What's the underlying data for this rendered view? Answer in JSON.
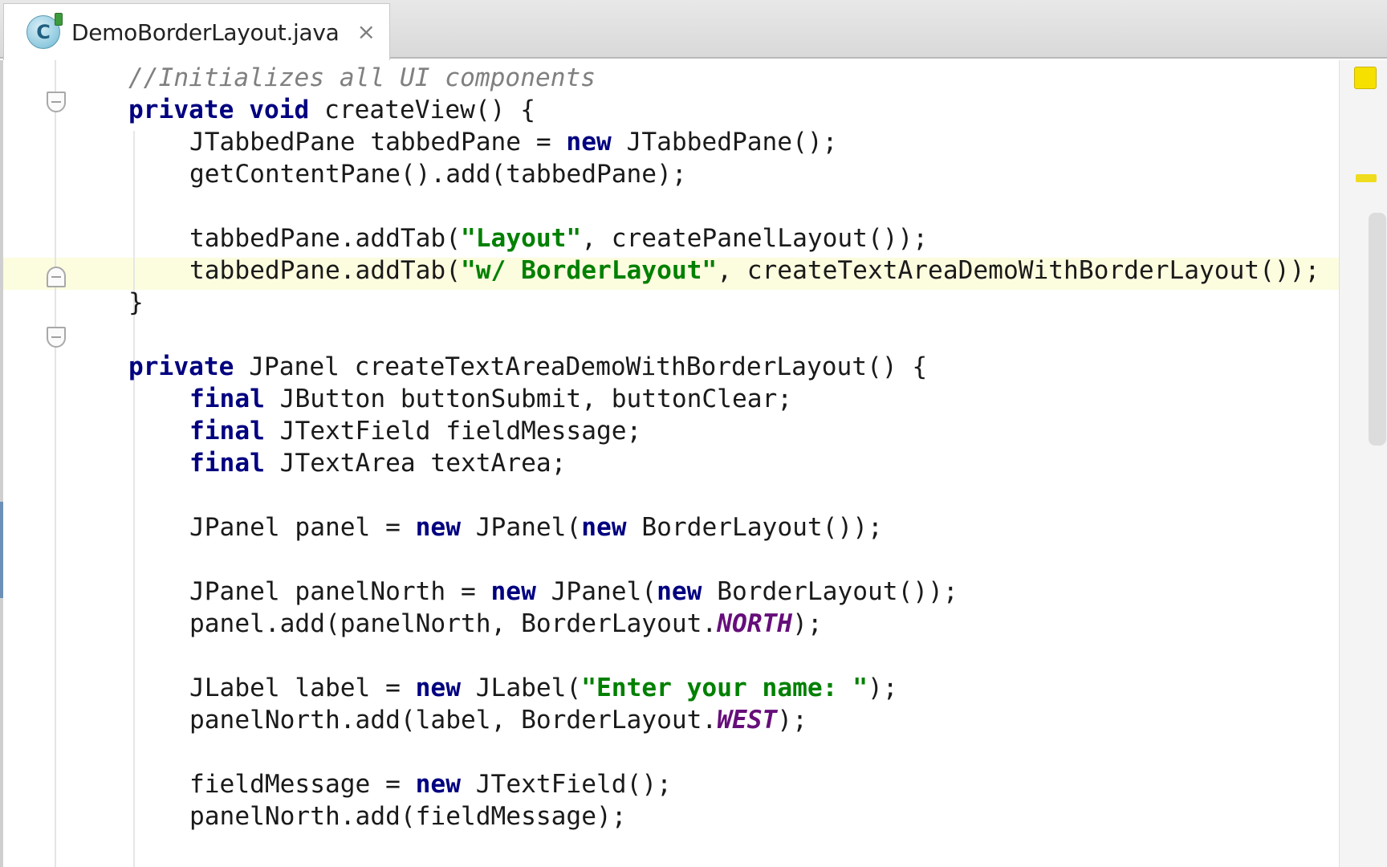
{
  "tab": {
    "title": "DemoBorderLayout.java",
    "close_glyph": "×",
    "icon_letter": "C",
    "icon": "java-class-icon"
  },
  "code": {
    "line1": "//Initializes all UI components",
    "line2": {
      "k1": "private",
      "k2": "void",
      "rest": " createView() {"
    },
    "line3": {
      "a": "JTabbedPane tabbedPane = ",
      "k": "new",
      "b": " JTabbedPane();"
    },
    "line4": "getContentPane().add(tabbedPane);",
    "line6": {
      "a": "tabbedPane.addTab(",
      "s": "\"Layout\"",
      "b": ", createPanelLayout());"
    },
    "line7": {
      "a": "tabbedPane.addTab(",
      "s": "\"w/ BorderLayout\"",
      "b": ", createTextAreaDemoWithBorderLayout());"
    },
    "line8": "}",
    "line10": {
      "k": "private",
      "rest": " JPanel createTextAreaDemoWithBorderLayout() {"
    },
    "line11": {
      "k": "final",
      "rest": " JButton buttonSubmit, buttonClear;"
    },
    "line12": {
      "k": "final",
      "rest": " JTextField fieldMessage;"
    },
    "line13": {
      "k": "final",
      "rest": " JTextArea textArea;"
    },
    "line15": {
      "a": "JPanel panel = ",
      "k1": "new",
      "b": " JPanel(",
      "k2": "new",
      "c": " BorderLayout());"
    },
    "line17": {
      "a": "JPanel panelNorth = ",
      "k1": "new",
      "b": " JPanel(",
      "k2": "new",
      "c": " BorderLayout());"
    },
    "line18": {
      "a": "panel.add(panelNorth, BorderLayout.",
      "const": "NORTH",
      "b": ");"
    },
    "line20": {
      "a": "JLabel label = ",
      "k": "new",
      "b": " JLabel(",
      "s": "\"Enter your name: \"",
      "c": ");"
    },
    "line21": {
      "a": "panelNorth.add(label, BorderLayout.",
      "const": "WEST",
      "b": ");"
    },
    "line23": {
      "a": "fieldMessage = ",
      "k": "new",
      "b": " JTextField();"
    },
    "line24": "panelNorth.add(fieldMessage);"
  },
  "colors": {
    "keyword": "#000080",
    "string": "#008000",
    "comment": "#808080",
    "constant": "#660e7a",
    "caret_line": "#fcfcdf",
    "status_ok": "#f5e000"
  }
}
